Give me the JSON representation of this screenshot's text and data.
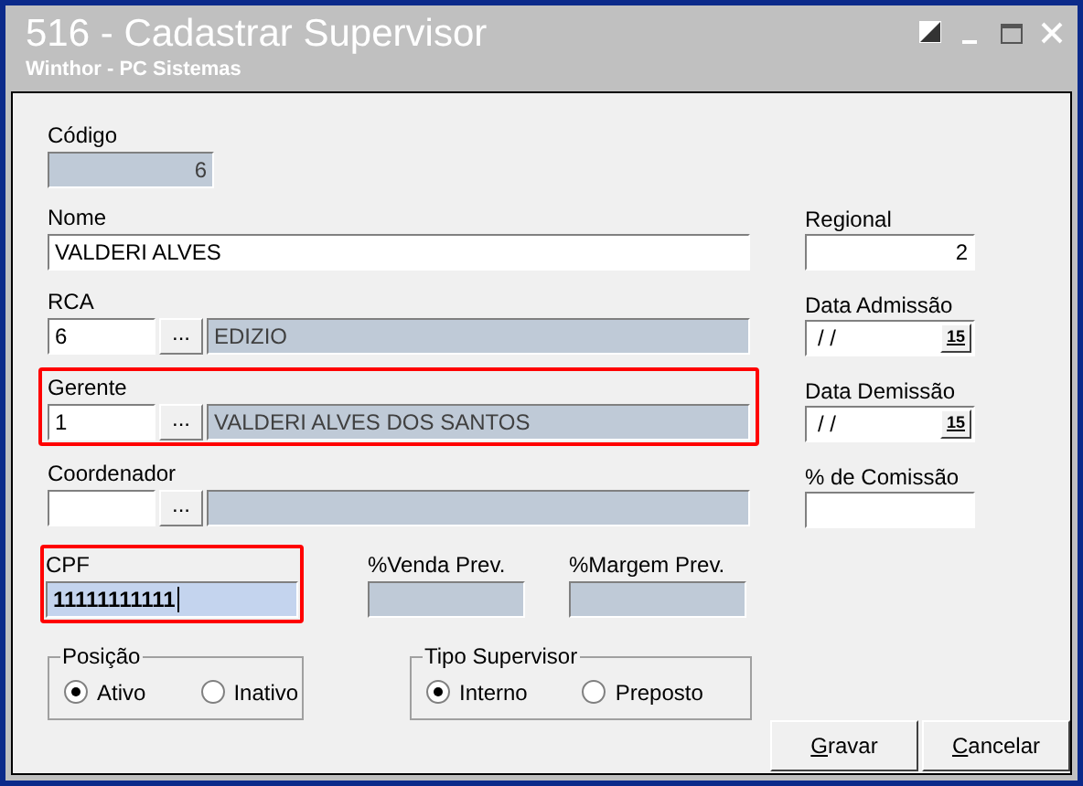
{
  "window": {
    "title": "516 - Cadastrar Supervisor",
    "subtitle": "Winthor - PC Sistemas"
  },
  "codigo": {
    "label": "Código",
    "value": "6"
  },
  "nome": {
    "label": "Nome",
    "value": "VALDERI ALVES"
  },
  "lookups": [
    {
      "label": "RCA",
      "code": "6",
      "button": "...",
      "description": "EDIZIO",
      "highlighted": false
    },
    {
      "label": "Gerente",
      "code": "1",
      "button": "...",
      "description": "VALDERI ALVES DOS SANTOS",
      "highlighted": true
    },
    {
      "label": "Coordenador",
      "button": "...",
      "highlighted": false
    }
  ],
  "cpf": {
    "label": "CPF",
    "value": "11111111111",
    "highlighted": true
  },
  "prev_fields": [
    {
      "label": "%Venda Prev."
    },
    {
      "label": "%Margem Prev."
    }
  ],
  "regional": {
    "label": "Regional",
    "value": "2"
  },
  "right_fields": [
    {
      "label": "Data Admissão",
      "kind": "date",
      "value": "/ /",
      "button": "15"
    },
    {
      "label": "Data Demissão",
      "kind": "date",
      "value": "/ /",
      "button": "15"
    },
    {
      "label": "% de Comissão",
      "kind": "number"
    }
  ],
  "radio_groups": [
    {
      "title": "Posição",
      "options": [
        {
          "label": "Ativo",
          "selected": true
        },
        {
          "label": "Inativo",
          "selected": false
        }
      ]
    },
    {
      "title": "Tipo Supervisor",
      "options": [
        {
          "label": "Interno",
          "selected": true
        },
        {
          "label": "Preposto",
          "selected": false
        }
      ]
    }
  ],
  "buttons": [
    {
      "label": "Gravar"
    },
    {
      "label": "Cancelar"
    }
  ]
}
